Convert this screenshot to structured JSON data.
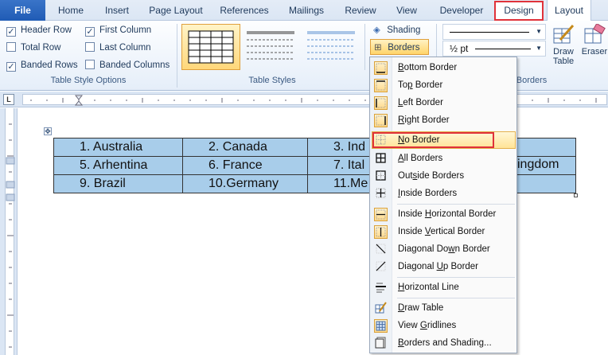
{
  "tabs": [
    "File",
    "Home",
    "Insert",
    "Page Layout",
    "References",
    "Mailings",
    "Review",
    "View",
    "Developer",
    "Design",
    "Layout"
  ],
  "ribbon": {
    "table_style_options": {
      "label": "Table Style Options",
      "checkboxes": [
        {
          "label": "Header Row",
          "checked": true
        },
        {
          "label": "First Column",
          "checked": true
        },
        {
          "label": "Total Row",
          "checked": false
        },
        {
          "label": "Last Column",
          "checked": false
        },
        {
          "label": "Banded Rows",
          "checked": true
        },
        {
          "label": "Banded Columns",
          "checked": false
        }
      ]
    },
    "table_styles_label": "Table Styles",
    "shading_label": "Shading",
    "borders_label": "Borders",
    "pen_weight": "½ pt",
    "draw_borders_label": "Borders",
    "draw_table_label": "Draw Table",
    "eraser_label": "Eraser"
  },
  "document": {
    "rows": [
      [
        "1.  Australia",
        "2.  Canada",
        "3.  Ind"
      ],
      [
        "5.  Arhentina",
        "6.  France",
        "7.  Ital"
      ],
      [
        "9.  Brazil",
        "10.Germany",
        "11.Me"
      ]
    ],
    "overflow_text": "ingdom"
  },
  "borders_menu": {
    "items": [
      {
        "label": "Bottom Border",
        "icon": "bottom-border-icon"
      },
      {
        "label": "Top Border",
        "icon": "top-border-icon"
      },
      {
        "label": "Left Border",
        "icon": "left-border-icon"
      },
      {
        "label": "Right Border",
        "icon": "right-border-icon"
      },
      {
        "label": "No Border",
        "icon": "no-border-icon"
      },
      {
        "label": "All Borders",
        "icon": "all-borders-icon"
      },
      {
        "label": "Outside Borders",
        "icon": "outside-borders-icon"
      },
      {
        "label": "Inside Borders",
        "icon": "inside-borders-icon"
      },
      {
        "label": "Inside Horizontal Border",
        "icon": "inside-horizontal-border-icon"
      },
      {
        "label": "Inside Vertical Border",
        "icon": "inside-vertical-border-icon"
      },
      {
        "label": "Diagonal Down Border",
        "icon": "diagonal-down-border-icon"
      },
      {
        "label": "Diagonal Up Border",
        "icon": "diagonal-up-border-icon"
      },
      {
        "label": "Horizontal Line",
        "icon": "horizontal-line-icon"
      },
      {
        "label": "Draw Table",
        "icon": "draw-table-icon"
      },
      {
        "label": "View Gridlines",
        "icon": "view-gridlines-icon"
      },
      {
        "label": "Borders and Shading...",
        "icon": "borders-and-shading-icon"
      }
    ],
    "highlighted": "No Border"
  },
  "colors": {
    "highlight_outline": "#e0323a",
    "table_fill": "#a8cdea",
    "file_tab": "#2a63bb"
  }
}
